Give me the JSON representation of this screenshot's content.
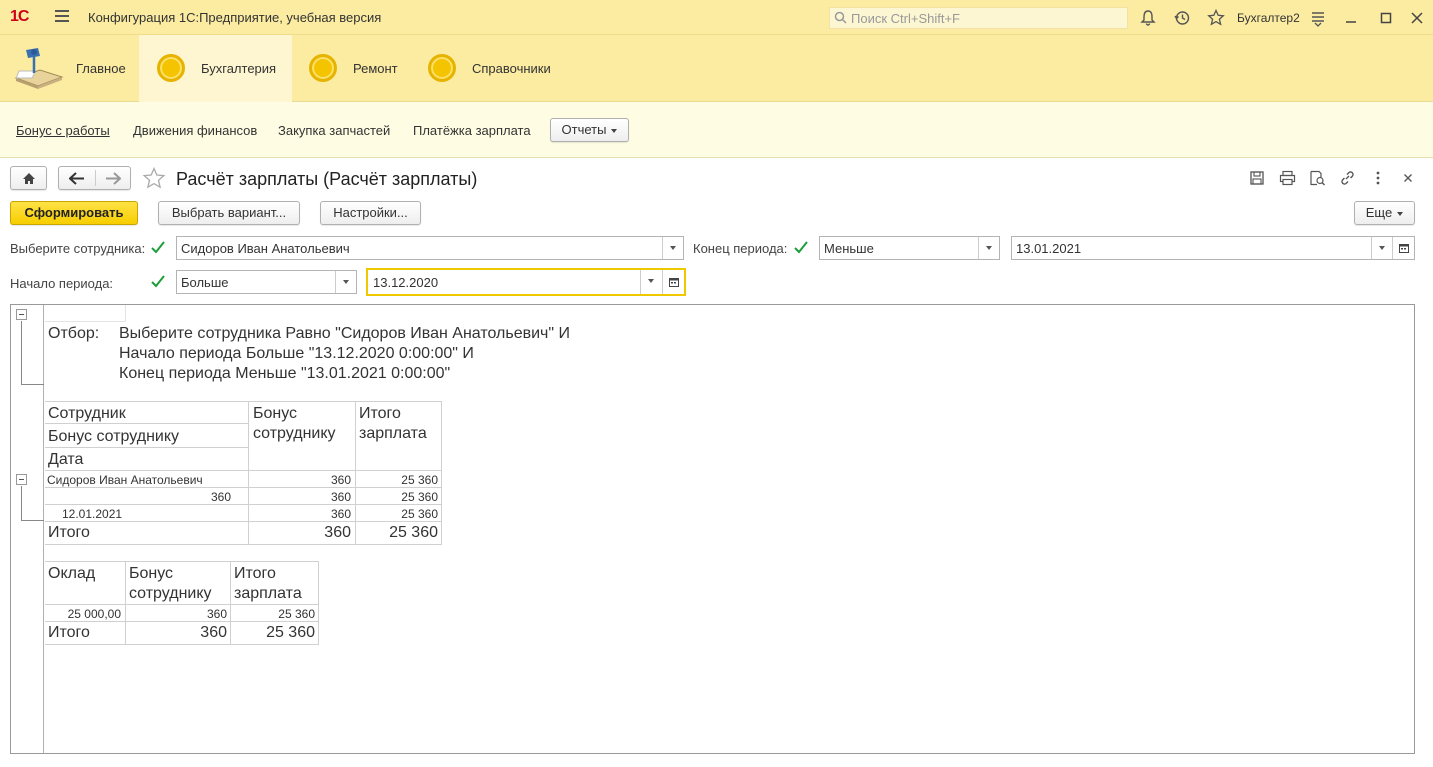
{
  "titlebar": {
    "logo": "1С",
    "app_title": "Конфигурация 1С:Предприятие, учебная версия",
    "search_placeholder": "Поиск Ctrl+Shift+F",
    "user": "Бухгалтер2"
  },
  "sections": [
    {
      "label": "Главное"
    },
    {
      "label": "Бухгалтерия"
    },
    {
      "label": "Ремонт"
    },
    {
      "label": "Справочники"
    }
  ],
  "commands": [
    "Бонус с работы",
    "Движения финансов",
    "Закупка запчастей",
    "Платёжка зарплата"
  ],
  "reports_menu": "Отчеты",
  "form": {
    "title": "Расчёт зарплаты (Расчёт зарплаты)",
    "generate": "Сформировать",
    "choose_variant": "Выбрать вариант...",
    "settings": "Настройки...",
    "more": "Еще"
  },
  "filters": {
    "employee_label": "Выберите сотрудника:",
    "employee_value": "Сидоров Иван Анатольевич",
    "end_label": "Конец периода:",
    "end_cond": "Меньше",
    "end_date": "13.01.2021",
    "start_label": "Начало периода:",
    "start_cond": "Больше",
    "start_date": "13.12.2020"
  },
  "report": {
    "filter_label": "Отбор:",
    "filter_lines": [
      "Выберите сотрудника Равно \"Сидоров Иван Анатольевич\" И",
      "Начало периода Больше \"13.12.2020 0:00:00\" И",
      "Конец периода Меньше \"13.01.2021 0:00:00\""
    ],
    "t1": {
      "h_col1": [
        "Сотрудник",
        "Бонус сотруднику",
        "Дата"
      ],
      "h_col2": [
        "Бонус",
        "сотруднику"
      ],
      "h_col3": [
        "Итого",
        "зарплата"
      ],
      "rows": [
        [
          "Сидоров Иван Анатольевич",
          "360",
          "25 360"
        ],
        [
          "360",
          "360",
          "25 360"
        ],
        [
          "12.01.2021",
          "360",
          "25 360"
        ]
      ],
      "total": [
        "Итого",
        "360",
        "25 360"
      ]
    },
    "t2": {
      "h_col1": "Оклад",
      "h_col2": [
        "Бонус",
        "сотруднику"
      ],
      "h_col3": [
        "Итого",
        "зарплата"
      ],
      "row": [
        "25 000,00",
        "360",
        "25 360"
      ],
      "total": [
        "Итого",
        "360",
        "25 360"
      ]
    }
  }
}
